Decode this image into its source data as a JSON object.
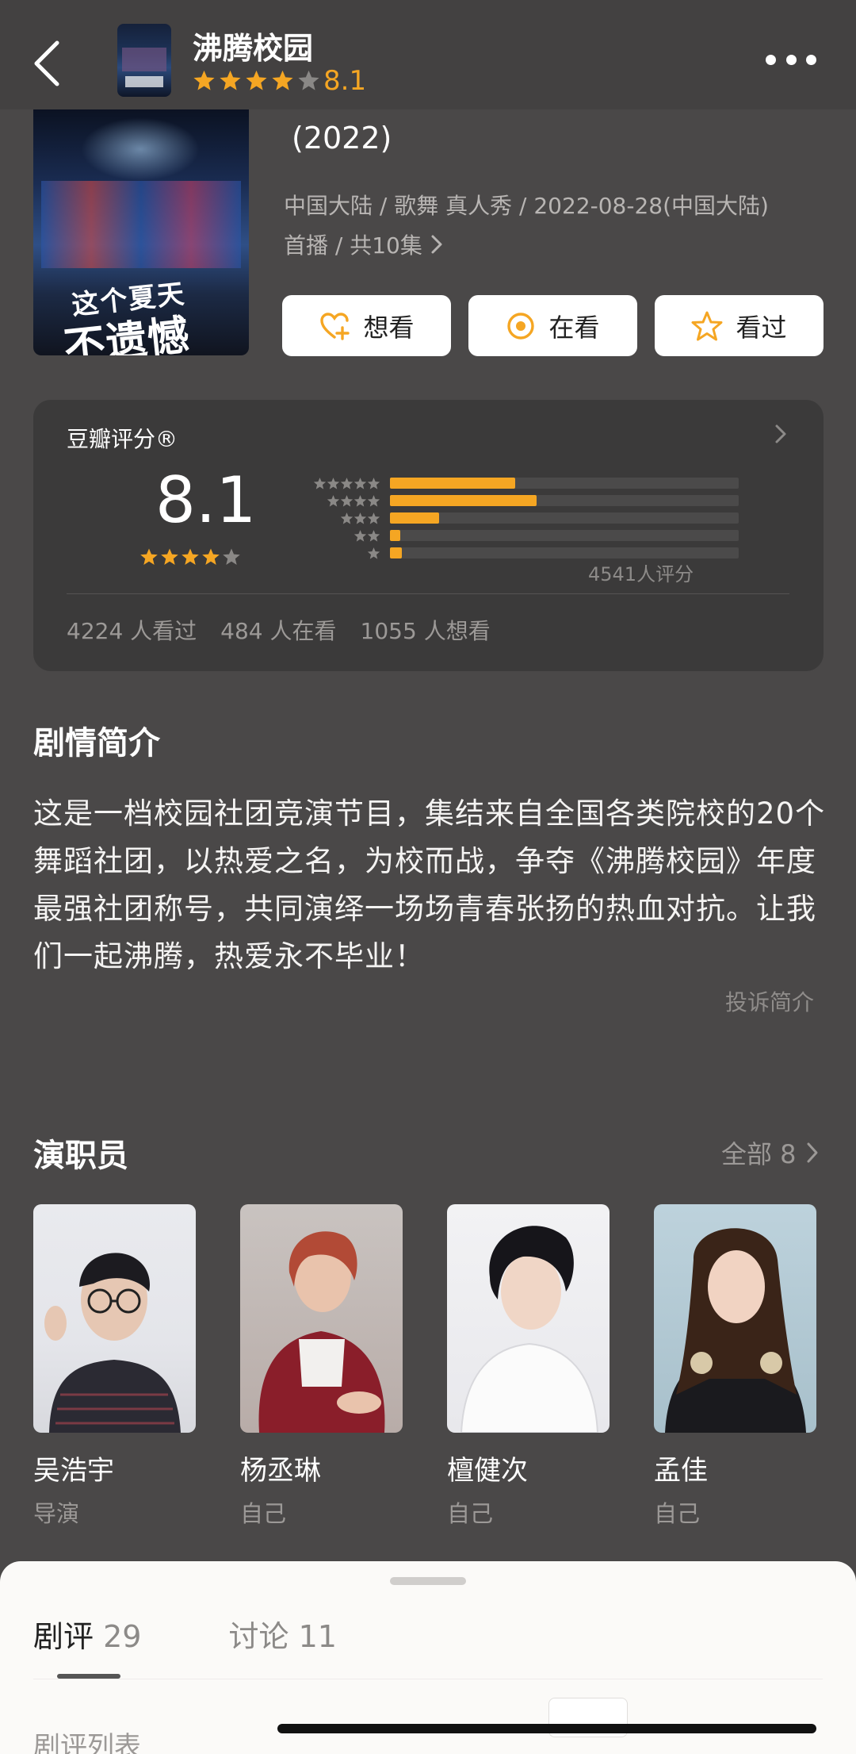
{
  "header": {
    "title": "沸腾校园",
    "score": "8.1",
    "star_count": 4
  },
  "show": {
    "year": "(2022)",
    "meta_line1": "中国大陆 / 歌舞 真人秀 / 2022-08-28(中国大陆)",
    "meta_line2": "首播 / 共10集",
    "poster_text_line1": "这个夏天",
    "poster_text_line2": "不遗憾"
  },
  "actions": {
    "want": "想看",
    "watching": "在看",
    "watched": "看过"
  },
  "rating": {
    "title": "豆瓣评分®",
    "score": "8.1",
    "star_count": 4,
    "distribution": [
      {
        "stars": 5,
        "fraction": 0.36
      },
      {
        "stars": 4,
        "fraction": 0.42
      },
      {
        "stars": 3,
        "fraction": 0.14
      },
      {
        "stars": 2,
        "fraction": 0.03
      },
      {
        "stars": 1,
        "fraction": 0.035
      }
    ],
    "count_text": "4541人评分",
    "watched": "4224 人看过",
    "watching": "484 人在看",
    "want": "1055 人想看"
  },
  "synopsis": {
    "title": "剧情简介",
    "text": "这是一档校园社团竞演节目，集结来自全国各类院校的20个舞蹈社团，以热爱之名，为校而战，争夺《沸腾校园》年度最强社团称号，共同演绎一场场青春张扬的热血对抗。让我们一起沸腾，热爱永不毕业！",
    "report": "投诉简介"
  },
  "cast": {
    "title": "演职员",
    "all_label": "全部 8",
    "members": [
      {
        "name": "吴浩宇",
        "role": "导演"
      },
      {
        "name": "杨丞琳",
        "role": "自己"
      },
      {
        "name": "檀健次",
        "role": "自己"
      },
      {
        "name": "孟佳",
        "role": "自己"
      }
    ]
  },
  "sheet": {
    "tab1_label": "剧评",
    "tab1_count": "29",
    "tab2_label": "讨论",
    "tab2_count": "11",
    "sub_title": "剧评列表"
  },
  "colors": {
    "accent": "#f5a623",
    "background": "#4a4848",
    "card": "#3b3a3a"
  }
}
